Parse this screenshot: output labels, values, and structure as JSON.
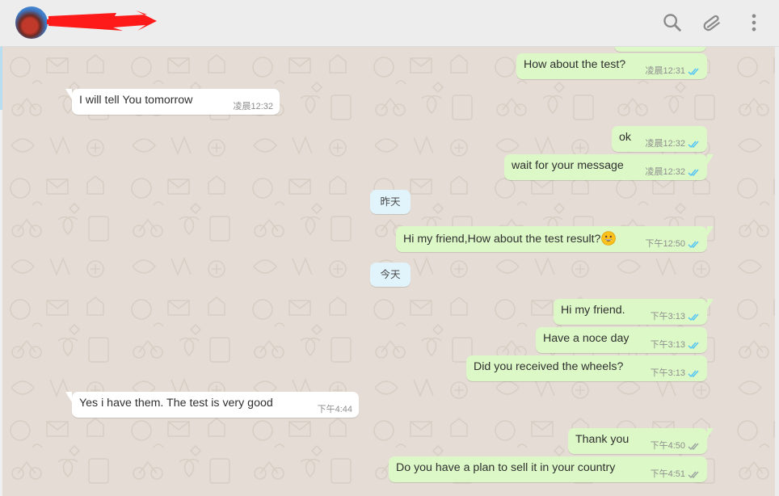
{
  "header": {
    "contact_name": "",
    "icons": [
      "search-icon",
      "attach-icon",
      "menu-icon"
    ]
  },
  "colors": {
    "outgoing_bubble": "#dcf8c6",
    "incoming_bubble": "#ffffff",
    "chat_background": "#e5ddd5",
    "read_tick": "#4fc3f7",
    "sent_tick": "#9aa3a0",
    "redaction_mark": "#ff1a1a"
  },
  "messages": [
    {
      "direction": "outgoing",
      "text": "How about the test?",
      "time": "凌晨12:31",
      "status": "read"
    },
    {
      "direction": "incoming",
      "text": "I will tell You tomorrow",
      "time": "凌晨12:32"
    },
    {
      "direction": "outgoing",
      "text": "ok",
      "time": "凌晨12:32",
      "status": "read"
    },
    {
      "direction": "outgoing",
      "text": "wait for your message",
      "time": "凌晨12:32",
      "status": "read"
    },
    {
      "type": "day-separator",
      "text": "昨天"
    },
    {
      "direction": "outgoing",
      "text": "Hi my friend,How about the test result?",
      "emoji": "grinning-face-emoji",
      "time": "下午12:50",
      "status": "read"
    },
    {
      "type": "day-separator",
      "text": "今天"
    },
    {
      "direction": "outgoing",
      "text": "Hi my friend.",
      "time": "下午3:13",
      "status": "read"
    },
    {
      "direction": "outgoing",
      "text": "Have a noce day",
      "time": "下午3:13",
      "status": "read"
    },
    {
      "direction": "outgoing",
      "text": "Did you received the wheels?",
      "time": "下午3:13",
      "status": "read"
    },
    {
      "direction": "incoming",
      "text": "Yes i have them. The test is very good",
      "time": "下午4:44"
    },
    {
      "direction": "outgoing",
      "text": "Thank you",
      "time": "下午4:50",
      "status": "delivered"
    },
    {
      "direction": "outgoing",
      "text": "Do you have a plan to sell it in your country",
      "time": "下午4:51",
      "status": "delivered"
    }
  ]
}
